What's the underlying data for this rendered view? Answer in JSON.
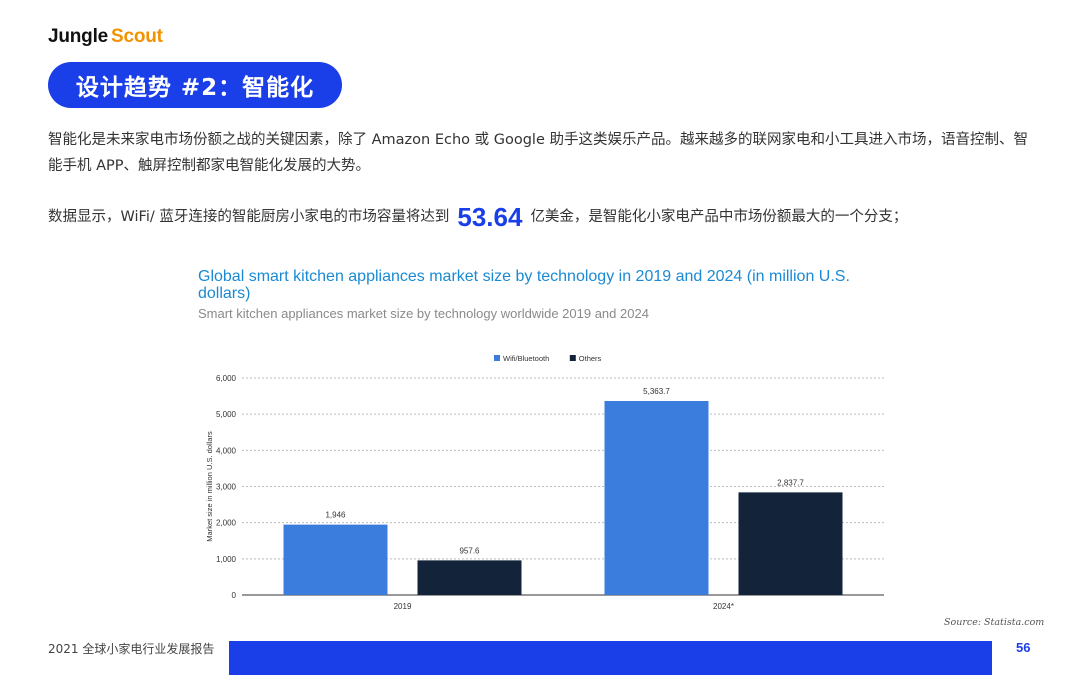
{
  "logo": {
    "part1": "Jungle",
    "part2": "Scout"
  },
  "section_title": "设计趋势 #2：智能化",
  "paragraph1": "智能化是未来家电市场份额之战的关键因素，除了 Amazon Echo 或 Google 助手这类娱乐产品。越来越多的联网家电和小工具进入市场，语音控制、智能手机 APP、触屏控制都家电智能化发展的大势。",
  "paragraph2": {
    "before": "数据显示，WiFi/ 蓝牙连接的智能厨房小家电的市场容量将达到",
    "highlight": "53.64",
    "after": "亿美金，是智能化小家电产品中市场份额最大的一个分支；"
  },
  "chart_data": {
    "type": "bar",
    "title": "Global smart kitchen appliances market size by technology in 2019 and 2024 (in million U.S. dollars)",
    "subtitle": "Smart kitchen appliances market size by technology worldwide 2019 and 2024",
    "categories": [
      "2019",
      "2024*"
    ],
    "series": [
      {
        "name": "Wifi/Bluetooth",
        "color": "#3b7ddd",
        "values": [
          1946,
          5363.7
        ],
        "labels": [
          "1,946",
          "5,363.7"
        ]
      },
      {
        "name": "Others",
        "color": "#13243a",
        "values": [
          957.6,
          2837.7
        ],
        "labels": [
          "957.6",
          "2,837.7"
        ]
      }
    ],
    "xlabel": "",
    "ylabel": "Market size in million U.S. dollars",
    "ylim": [
      0,
      6000
    ],
    "yticks": [
      0,
      1000,
      2000,
      3000,
      4000,
      5000,
      6000
    ],
    "ytick_labels": [
      "0",
      "1,000",
      "2,000",
      "3,000",
      "4,000",
      "5,000",
      "6,000"
    ],
    "grid": true,
    "legend": "top-center"
  },
  "source": "Source: Statista.com",
  "footer": {
    "report": "2021 全球小家电行业发展报告",
    "page": "56"
  }
}
